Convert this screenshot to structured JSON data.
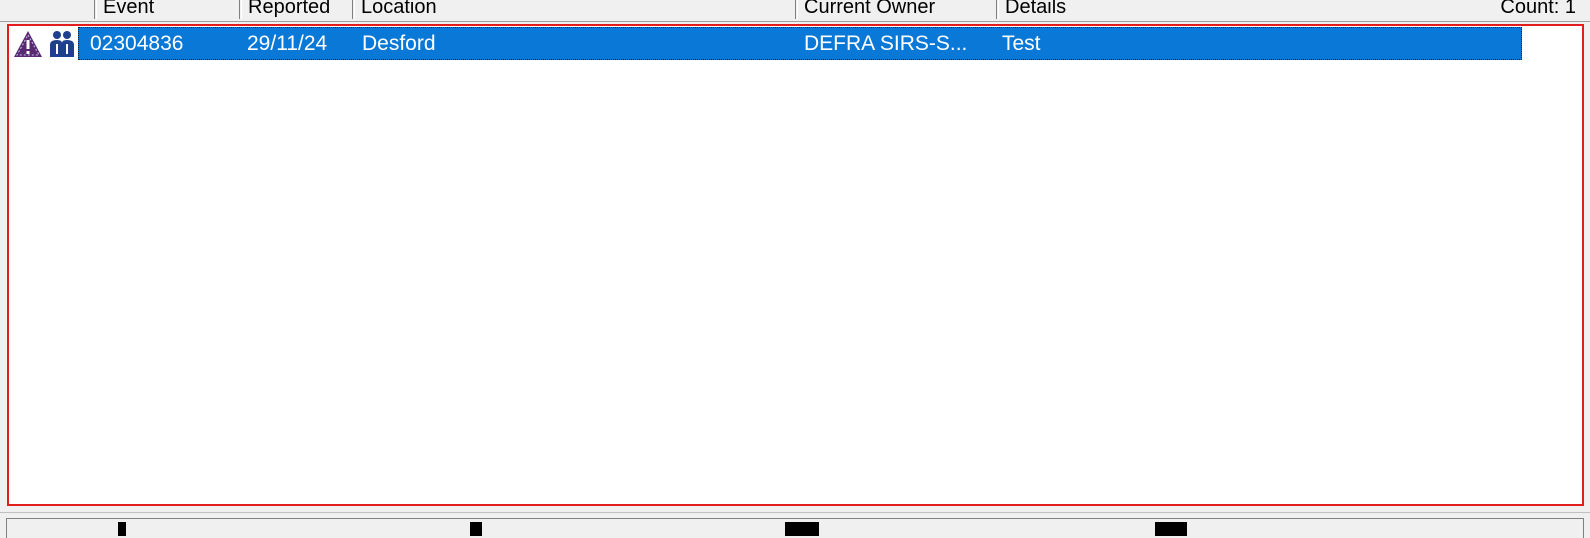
{
  "header": {
    "columns": {
      "event": "Event",
      "reported": "Reported",
      "location": "Location",
      "current_owner": "Current Owner",
      "details": "Details"
    },
    "count_label": "Count: 1"
  },
  "rows": [
    {
      "icons": [
        "warning-triangle-icon",
        "person-icon"
      ],
      "event": "02304836",
      "reported": "29/11/24",
      "location": "Desford",
      "current_owner": "DEFRA SIRS-S...",
      "details": "Test",
      "selected": true
    }
  ],
  "colors": {
    "selection": "#0a78d7",
    "list_border": "#e21d1d",
    "warning_icon": "#5a2a6e",
    "person_icon": "#1f3f8f"
  }
}
